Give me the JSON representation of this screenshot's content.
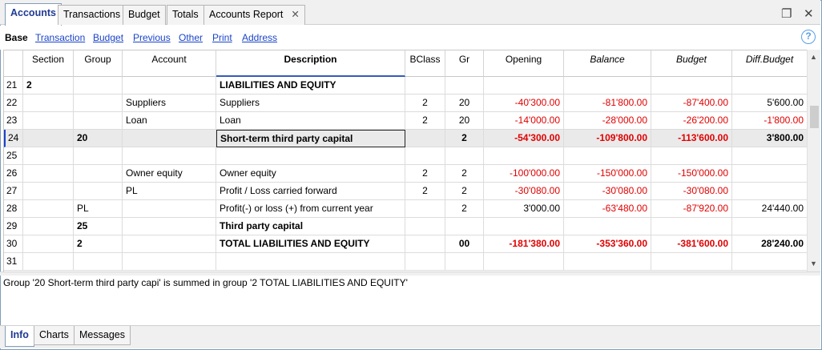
{
  "tabs": [
    "Accounts",
    "Transactions",
    "Budget",
    "Totals",
    "Accounts Report"
  ],
  "views": [
    "Base",
    "Transaction",
    "Budget",
    "Previous",
    "Other",
    "Print",
    "Address"
  ],
  "columns": [
    "Section",
    "Group",
    "Account",
    "Description",
    "BClass",
    "Gr",
    "Opening",
    "Balance",
    "Budget",
    "Diff.Budget"
  ],
  "rows": [
    {
      "n": "21",
      "section": "2",
      "group": "",
      "account": "",
      "desc": "LIABILITIES AND EQUITY",
      "bclass": "",
      "gr": "",
      "opening": "",
      "balance": "",
      "budget": "",
      "diff": ""
    },
    {
      "n": "22",
      "section": "",
      "group": "",
      "account": "Suppliers",
      "desc": "Suppliers",
      "bclass": "2",
      "gr": "20",
      "opening": "-40'300.00",
      "balance": "-81'800.00",
      "budget": "-87'400.00",
      "diff": "5'600.00"
    },
    {
      "n": "23",
      "section": "",
      "group": "",
      "account": "Loan",
      "desc": "Loan",
      "bclass": "2",
      "gr": "20",
      "opening": "-14'000.00",
      "balance": "-28'000.00",
      "budget": "-26'200.00",
      "diff": "-1'800.00"
    },
    {
      "n": "24",
      "section": "",
      "group": "20",
      "account": "",
      "desc": "Short-term third party capital",
      "bclass": "",
      "gr": "2",
      "opening": "-54'300.00",
      "balance": "-109'800.00",
      "budget": "-113'600.00",
      "diff": "3'800.00"
    },
    {
      "n": "25",
      "section": "",
      "group": "",
      "account": "",
      "desc": "",
      "bclass": "",
      "gr": "",
      "opening": "",
      "balance": "",
      "budget": "",
      "diff": ""
    },
    {
      "n": "26",
      "section": "",
      "group": "",
      "account": "Owner equity",
      "desc": "Owner equity",
      "bclass": "2",
      "gr": "2",
      "opening": "-100'000.00",
      "balance": "-150'000.00",
      "budget": "-150'000.00",
      "diff": ""
    },
    {
      "n": "27",
      "section": "",
      "group": "",
      "account": "PL",
      "desc": "Profit / Loss carried forward",
      "bclass": "2",
      "gr": "2",
      "opening": "-30'080.00",
      "balance": "-30'080.00",
      "budget": "-30'080.00",
      "diff": ""
    },
    {
      "n": "28",
      "section": "",
      "group": "PL",
      "account": "",
      "desc": "Profit(-) or loss (+) from current year",
      "bclass": "",
      "gr": "2",
      "opening": "3'000.00",
      "balance": "-63'480.00",
      "budget": "-87'920.00",
      "diff": "24'440.00"
    },
    {
      "n": "29",
      "section": "",
      "group": "25",
      "account": "",
      "desc": "Third party capital",
      "bclass": "",
      "gr": "",
      "opening": "",
      "balance": "",
      "budget": "",
      "diff": ""
    },
    {
      "n": "30",
      "section": "",
      "group": "2",
      "account": "",
      "desc": "TOTAL LIABILITIES AND EQUITY",
      "bclass": "",
      "gr": "00",
      "opening": "-181'380.00",
      "balance": "-353'360.00",
      "budget": "-381'600.00",
      "diff": "28'240.00"
    },
    {
      "n": "31",
      "section": "",
      "group": "",
      "account": "",
      "desc": "",
      "bclass": "",
      "gr": "",
      "opening": "",
      "balance": "",
      "budget": "",
      "diff": ""
    }
  ],
  "info_message": "Group '20 Short-term third party capi' is summed in group '2 TOTAL LIABILITIES AND EQUITY'",
  "bottom_tabs": [
    "Info",
    "Charts",
    "Messages"
  ],
  "colors": {
    "negative": "#e00000",
    "link": "#1a44c8",
    "active_tab": "#1f3a93"
  },
  "icons": {
    "tab_close": "close-icon",
    "restore": "restore-window-icon",
    "help": "help-icon"
  }
}
